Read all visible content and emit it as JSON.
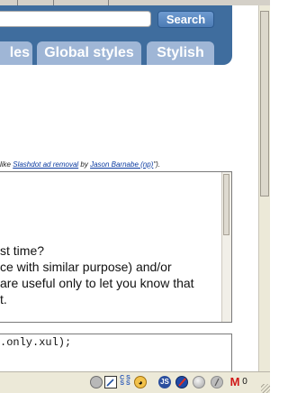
{
  "header": {
    "search_button": "Search",
    "tabs": [
      "les",
      "Global styles",
      "Stylish"
    ]
  },
  "attribution": {
    "prefix": "like ",
    "link1": "Slashdot ad removal",
    "middle": " by ",
    "link2": "Jason Barnabe (np)",
    "suffix": "\")."
  },
  "textbox": {
    "lines": [
      "st time?",
      "ce with similar purpose) and/or",
      "are useful only to let you know that",
      "t."
    ]
  },
  "codebox": {
    "code": ".only.xul);"
  },
  "statusbar": {
    "icons": [
      "gear-icon",
      "edit-icon",
      "css-icon",
      "face-icon",
      "javascript-icon",
      "stop-icon",
      "grey-circle-icon",
      "slash-icon",
      "gmail-icon"
    ],
    "mail_count": "0"
  }
}
